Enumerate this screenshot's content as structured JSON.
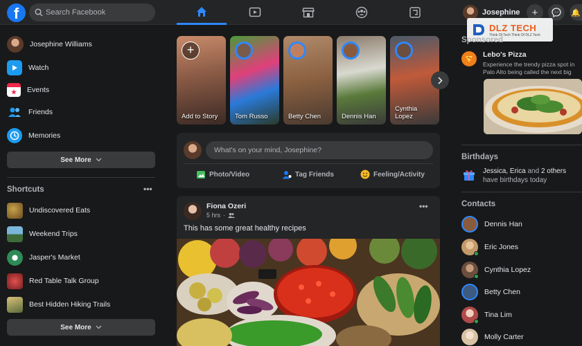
{
  "header": {
    "logo_letter": "f",
    "search_placeholder": "Search Facebook",
    "profile_name": "Josephine",
    "tabs": [
      "home",
      "watch",
      "marketplace",
      "groups",
      "gaming"
    ]
  },
  "left": {
    "items": [
      {
        "label": "Josephine Williams",
        "icon": "avatar"
      },
      {
        "label": "Watch",
        "icon": "watch-icon"
      },
      {
        "label": "Events",
        "icon": "events-icon"
      },
      {
        "label": "Friends",
        "icon": "friends-icon"
      },
      {
        "label": "Memories",
        "icon": "memories-icon"
      }
    ],
    "see_more": "See More",
    "shortcuts_title": "Shortcuts",
    "shortcuts": [
      {
        "label": "Undiscovered Eats"
      },
      {
        "label": "Weekend Trips"
      },
      {
        "label": "Jasper's Market"
      },
      {
        "label": "Red Table Talk Group"
      },
      {
        "label": "Best Hidden Hiking Trails"
      }
    ],
    "see_more_2": "See More"
  },
  "stories": [
    {
      "name": "Add to Story"
    },
    {
      "name": "Tom Russo"
    },
    {
      "name": "Betty Chen"
    },
    {
      "name": "Dennis Han"
    },
    {
      "name": "Cynthia Lopez"
    }
  ],
  "composer": {
    "placeholder": "What's on your mind, Josephine?",
    "actions": [
      {
        "label": "Photo/Video",
        "icon": "photo-icon",
        "color": "#45bd62"
      },
      {
        "label": "Tag Friends",
        "icon": "tag-friends-icon",
        "color": "#1877f2"
      },
      {
        "label": "Feeling/Activity",
        "icon": "feeling-icon",
        "color": "#f7b928"
      }
    ]
  },
  "post": {
    "author": "Fiona Ozeri",
    "time": "5 hrs",
    "text": "This has some great healthy recipes"
  },
  "right": {
    "sponsored_title": "Sponsored",
    "ad": {
      "name": "Lebo's Pizza",
      "desc": "Experience the trendy pizza spot in Palo Alto being called the next big thing."
    },
    "birthdays_title": "Birthdays",
    "birthday_names": "Jessica, Erica",
    "birthday_and": "and",
    "birthday_others": "2 others",
    "birthday_rest": "have birthdays today",
    "contacts_title": "Contacts",
    "contacts": [
      {
        "name": "Dennis Han",
        "color": "#8a5a3c"
      },
      {
        "name": "Eric Jones",
        "color": "#c49a6c"
      },
      {
        "name": "Cynthia Lopez",
        "color": "#6b4e3d"
      },
      {
        "name": "Betty Chen",
        "color": "#3d5a80"
      },
      {
        "name": "Tina Lim",
        "color": "#b04a4a"
      },
      {
        "name": "Molly Carter",
        "color": "#d9c3a5"
      }
    ]
  },
  "watermark": {
    "brand": "DLZ TECH",
    "tagline": "Think Of Tech Think Of DLZ Tech"
  },
  "colors": {
    "accent": "#2d88ff",
    "bg": "#18191a",
    "surface": "#242526",
    "online": "#31a24c"
  }
}
